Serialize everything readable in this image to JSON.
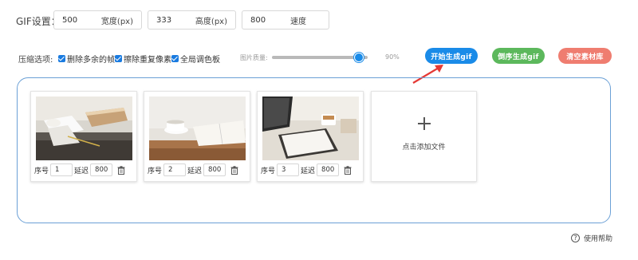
{
  "settings": {
    "label": "GIF设置：",
    "width": {
      "value": "500",
      "unit": "宽度(px)"
    },
    "height": {
      "value": "333",
      "unit": "高度(px)"
    },
    "speed": {
      "value": "800",
      "unit": "速度"
    }
  },
  "compression": {
    "label": "压缩选项:",
    "options": [
      {
        "label": "删除多余的帧",
        "checked": true
      },
      {
        "label": "擦除重复像素",
        "checked": true
      },
      {
        "label": "全局调色板",
        "checked": true
      }
    ],
    "quality_label": "图片质量:",
    "quality_value_text": "90%",
    "quality_fraction": 0.9
  },
  "buttons": {
    "start": {
      "label": "开始生成gif",
      "color": "#1a8be8"
    },
    "reverse": {
      "label": "倒序生成gif",
      "color": "#5cb85c"
    },
    "clear": {
      "label": "清空素材库",
      "color": "#ef7d70"
    }
  },
  "frames": [
    {
      "seq_label": "序号",
      "seq": "1",
      "delay_label": "延迟",
      "delay": "800",
      "thumb": "notebook-coffee-table"
    },
    {
      "seq_label": "序号",
      "seq": "2",
      "delay_label": "延迟",
      "delay": "800",
      "thumb": "coffee-cup-open-book"
    },
    {
      "seq_label": "序号",
      "seq": "3",
      "delay_label": "延迟",
      "delay": "800",
      "thumb": "laptop-notebook-desk"
    }
  ],
  "add_file_label": "点击添加文件",
  "help_label": "使用帮助",
  "accent": "#1a8be8",
  "arrow_color": "#e53935"
}
